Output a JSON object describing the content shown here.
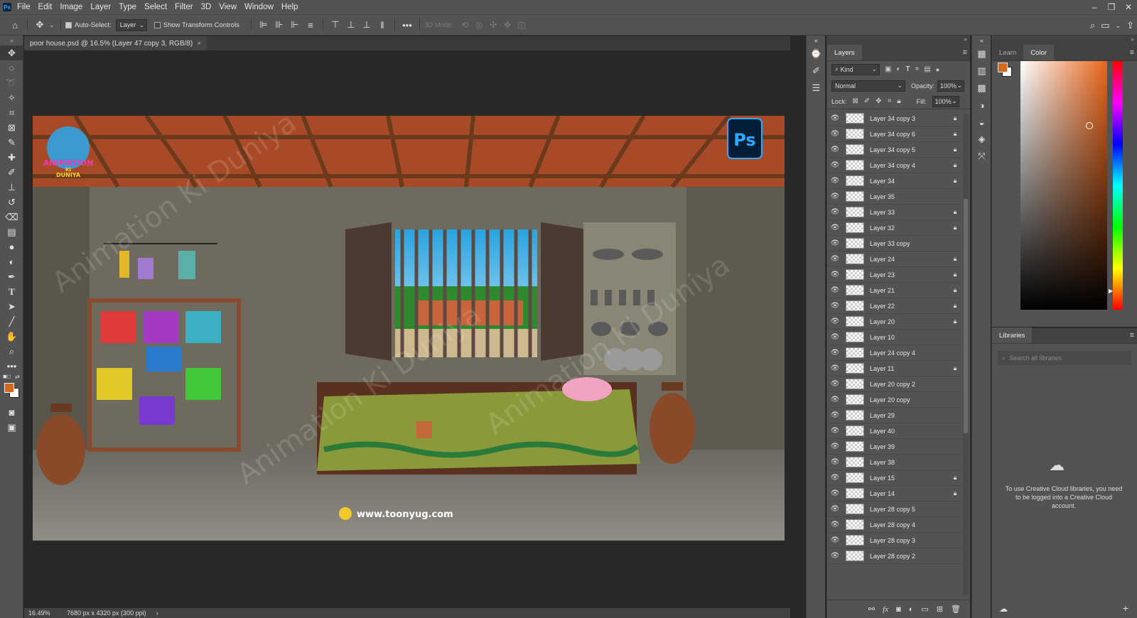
{
  "menubar": {
    "logo": "Ps",
    "items": [
      "File",
      "Edit",
      "Image",
      "Layer",
      "Type",
      "Select",
      "Filter",
      "3D",
      "View",
      "Window",
      "Help"
    ],
    "window_controls": [
      "–",
      "❐",
      "✕"
    ]
  },
  "options": {
    "auto_select_label": "Auto-Select:",
    "auto_select_value": "Layer",
    "show_transform_label": "Show Transform Controls",
    "mode_3d_label": "3D Mode:"
  },
  "document": {
    "tab_title": "poor house.psd @ 16.5% (Layer 47 copy 3, RGB/8)",
    "zoom": "16.49%",
    "doc_info": "7680 px x 4320 px (300 ppi)"
  },
  "artwork": {
    "ps_badge": "Ps",
    "logo_line1": "ANIMATION",
    "logo_line2": "KI",
    "logo_line3": "DUNIYA",
    "website": "www.toonyug.com",
    "watermark": "Animation Ki Duniya"
  },
  "layers_panel": {
    "tab": "Layers",
    "kind_label": "Kind",
    "blend_mode": "Normal",
    "opacity_label": "Opacity:",
    "opacity_value": "100%",
    "lock_label": "Lock:",
    "fill_label": "Fill:",
    "fill_value": "100%",
    "layers": [
      {
        "name": "Layer 34 copy 3",
        "locked": true
      },
      {
        "name": "Layer 34 copy 6",
        "locked": true
      },
      {
        "name": "Layer 34 copy 5",
        "locked": true
      },
      {
        "name": "Layer 34 copy 4",
        "locked": true
      },
      {
        "name": "Layer 34",
        "locked": true
      },
      {
        "name": "Layer 35",
        "locked": false
      },
      {
        "name": "Layer 33",
        "locked": true
      },
      {
        "name": "Layer 32",
        "locked": true
      },
      {
        "name": "Layer 33 copy",
        "locked": false
      },
      {
        "name": "Layer 24",
        "locked": true
      },
      {
        "name": "Layer 23",
        "locked": true
      },
      {
        "name": "Layer 21",
        "locked": true
      },
      {
        "name": "Layer 22",
        "locked": true
      },
      {
        "name": "Layer 20",
        "locked": true
      },
      {
        "name": "Layer 10",
        "locked": false
      },
      {
        "name": "Layer 24 copy 4",
        "locked": false
      },
      {
        "name": "Layer 11",
        "locked": true
      },
      {
        "name": "Layer 20 copy 2",
        "locked": false
      },
      {
        "name": "Layer 20 copy",
        "locked": false
      },
      {
        "name": "Layer 29",
        "locked": false
      },
      {
        "name": "Layer 40",
        "locked": false
      },
      {
        "name": "Layer 39",
        "locked": false
      },
      {
        "name": "Layer 38",
        "locked": false
      },
      {
        "name": "Layer 15",
        "locked": true
      },
      {
        "name": "Layer 14",
        "locked": true
      },
      {
        "name": "Layer 28 copy 5",
        "locked": false
      },
      {
        "name": "Layer 28 copy 4",
        "locked": false
      },
      {
        "name": "Layer 28 copy 3",
        "locked": false
      },
      {
        "name": "Layer 28 copy 2",
        "locked": false
      }
    ]
  },
  "color_panel": {
    "tabs": [
      "Learn",
      "Color"
    ],
    "foreground": "#d2691e",
    "background": "#ffffff"
  },
  "libraries_panel": {
    "tab": "Libraries",
    "search_placeholder": "Search all libraries",
    "message": "To use Creative Cloud libraries, you need to be logged into a Creative Cloud account."
  }
}
